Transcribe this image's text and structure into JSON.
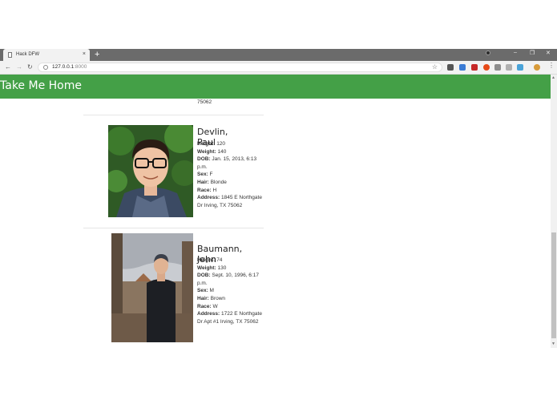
{
  "browser": {
    "tab_title": "Hack DFW",
    "tab_close": "×",
    "new_tab": "+",
    "url_host": "127.0.0.1",
    "url_port": ":8000",
    "min_glyph": "–",
    "max_glyph": "❐",
    "close_glyph": "✕",
    "back_glyph": "←",
    "forward_glyph": "→",
    "reload_glyph": "↻",
    "star_glyph": "☆",
    "menu_glyph": "⋮"
  },
  "header": {
    "title": "Take Me Home"
  },
  "previous_entry_tail": [
    "75062"
  ],
  "people": [
    {
      "name": "Devlin, Paul",
      "fields": [
        {
          "label": "Height:",
          "value": " 120"
        },
        {
          "label": "Weight:",
          "value": " 140"
        },
        {
          "label": "DOB:",
          "value": " Jan. 15, 2013, 6:13 p.m."
        },
        {
          "label": "Sex:",
          "value": " F"
        },
        {
          "label": "Hair:",
          "value": " Blonde"
        },
        {
          "label": "Race:",
          "value": " H"
        },
        {
          "label": "Address:",
          "value": " 1845 E Northgate Dr Irving, TX 75062"
        }
      ]
    },
    {
      "name": "Baumann, John",
      "fields": [
        {
          "label": "Height:",
          "value": " 74"
        },
        {
          "label": "Weight:",
          "value": " 130"
        },
        {
          "label": "DOB:",
          "value": " Sept. 10, 1996, 6:17 p.m."
        },
        {
          "label": "Sex:",
          "value": " M"
        },
        {
          "label": "Hair:",
          "value": " Brown"
        },
        {
          "label": "Race:",
          "value": " W"
        },
        {
          "label": "Address:",
          "value": " 1722 E Northgate Dr Apt #1 Irving, TX 75062"
        }
      ]
    }
  ],
  "colors": {
    "header_green": "#44a047",
    "tabstrip": "#6b6b6b"
  }
}
